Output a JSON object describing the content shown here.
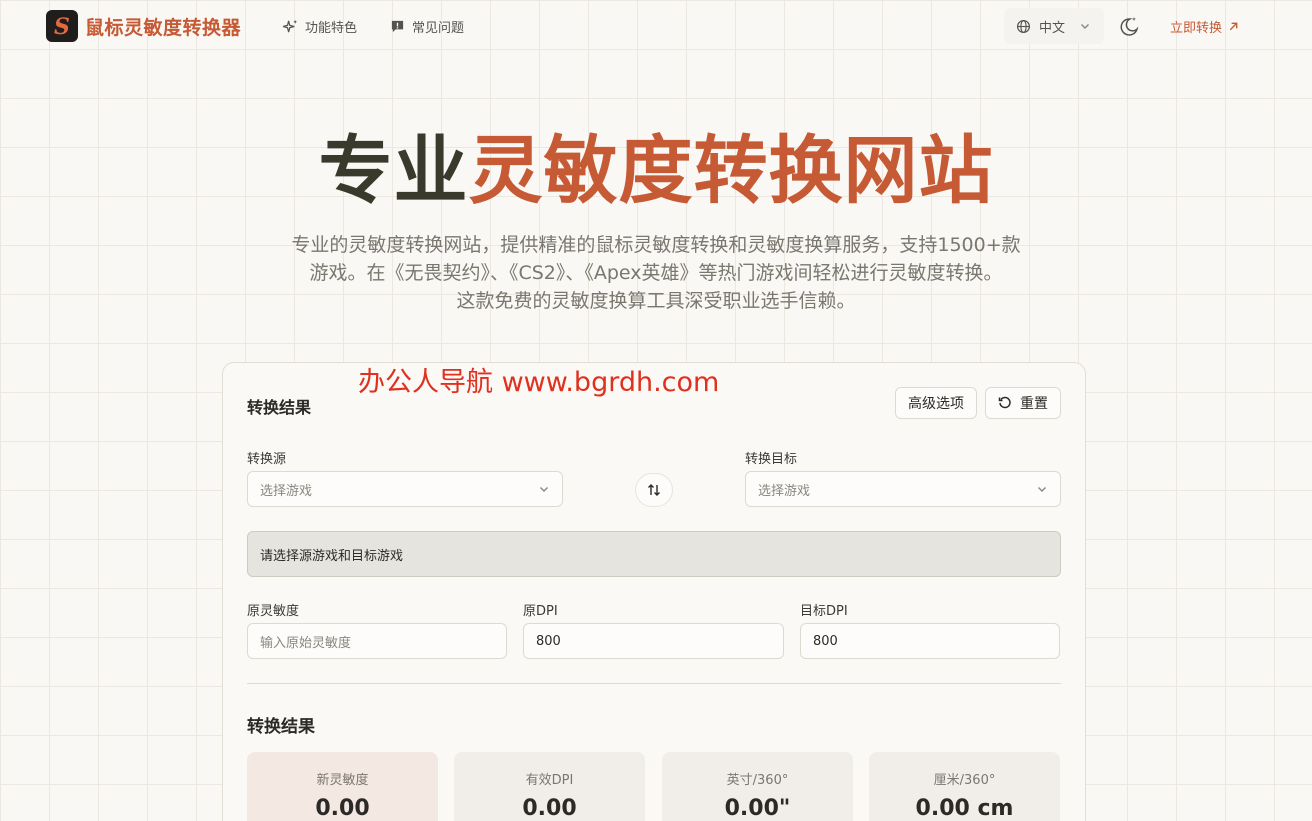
{
  "header": {
    "brand": "鼠标灵敏度转换器",
    "logo_glyph": "S",
    "nav": [
      {
        "label": "功能特色",
        "icon": "sparkle-icon"
      },
      {
        "label": "常见问题",
        "icon": "message-icon"
      }
    ],
    "language": "中文",
    "cta": "立即转换"
  },
  "hero": {
    "title_part1": "专业",
    "title_part2": "灵敏度转换网站",
    "description_line1": "专业的灵敏度转换网站，提供精准的鼠标灵敏度转换和灵敏度换算服务，支持1500+款",
    "description_line2": "游戏。在《无畏契约》、《CS2》、《Apex英雄》等热门游戏间轻松进行灵敏度转换。",
    "description_line3": "这款免费的灵敏度换算工具深受职业选手信赖。"
  },
  "watermark": "办公人导航 www.bgrdh.com",
  "converter": {
    "title": "转换结果",
    "advanced_label": "高级选项",
    "reset_label": "重置",
    "source_label": "转换源",
    "source_placeholder": "选择游戏",
    "target_label": "转换目标",
    "target_placeholder": "选择游戏",
    "notice": "请选择源游戏和目标游戏",
    "orig_sens_label": "原灵敏度",
    "orig_sens_placeholder": "输入原始灵敏度",
    "orig_dpi_label": "原DPI",
    "orig_dpi_value": "800",
    "target_dpi_label": "目标DPI",
    "target_dpi_value": "800",
    "results_title": "转换结果",
    "results": [
      {
        "label": "新灵敏度",
        "value": "0.00"
      },
      {
        "label": "有效DPI",
        "value": "0.00"
      },
      {
        "label": "英寸/360°",
        "value": "0.00\""
      },
      {
        "label": "厘米/360°",
        "value": "0.00 cm"
      }
    ]
  },
  "colors": {
    "accent": "#c55a35",
    "background": "#faf8f5",
    "watermark": "#e0301e"
  }
}
